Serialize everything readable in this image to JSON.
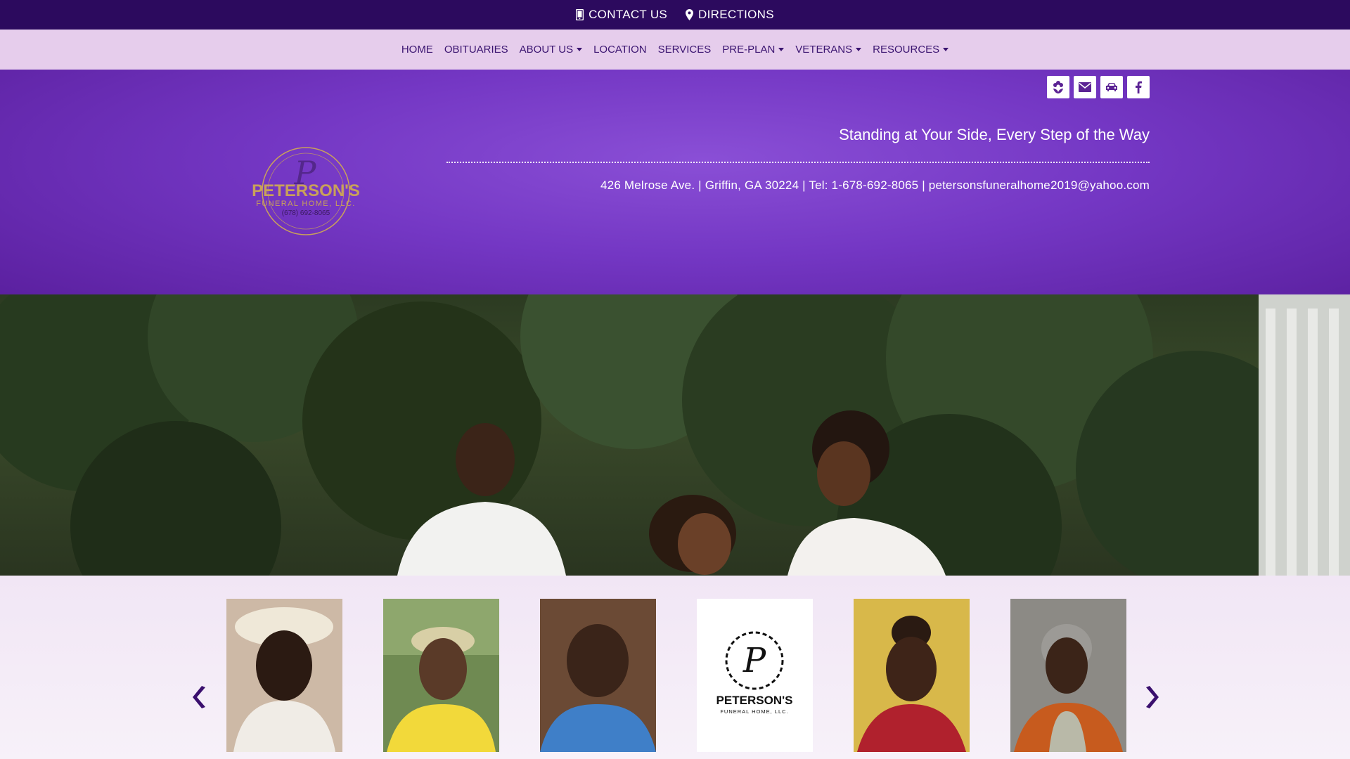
{
  "topbar": {
    "contact_label": "CONTACT US",
    "directions_label": "DIRECTIONS"
  },
  "nav": {
    "items": [
      {
        "label": "HOME",
        "dropdown": false
      },
      {
        "label": "OBITUARIES",
        "dropdown": false
      },
      {
        "label": "ABOUT US",
        "dropdown": true
      },
      {
        "label": "LOCATION",
        "dropdown": false
      },
      {
        "label": "SERVICES",
        "dropdown": false
      },
      {
        "label": "PRE-PLAN",
        "dropdown": true
      },
      {
        "label": "VETERANS",
        "dropdown": true
      },
      {
        "label": "RESOURCES",
        "dropdown": true
      }
    ]
  },
  "header": {
    "tagline": "Standing at Your Side, Every Step of the Way",
    "contact_line": "426 Melrose Ave. | Griffin, GA 30224 | Tel: 1-678-692-8065 | petersonsfuneralhome2019@yahoo.com",
    "social_icons": [
      "flower-icon",
      "email-icon",
      "car-icon",
      "facebook-icon"
    ],
    "logo": {
      "name": "PETERSON'S",
      "subtitle": "FUNERAL HOME, LLC.",
      "phone": "(678) 692-8065"
    }
  },
  "carousel": {
    "cards": [
      {
        "kind": "portrait"
      },
      {
        "kind": "portrait"
      },
      {
        "kind": "portrait"
      },
      {
        "kind": "logo",
        "name": "PETERSON'S",
        "subtitle": "FUNERAL HOME, LLC."
      },
      {
        "kind": "portrait"
      },
      {
        "kind": "portrait"
      }
    ]
  },
  "colors": {
    "topbar": "#2c0a5e",
    "nav": "#e6cdec",
    "header_purple": "#7437c4",
    "accent_gold": "#c9a15a"
  }
}
